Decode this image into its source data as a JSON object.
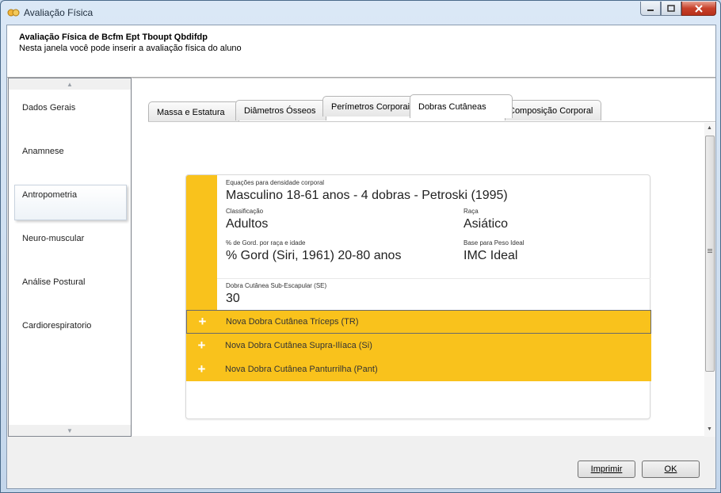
{
  "window": {
    "title": "Avaliação Física"
  },
  "header": {
    "title": "Avaliação Física de Bcfm Ept Tboupt Qbdifdp",
    "subtitle": "Nesta janela você pode inserir a avaliação física do aluno"
  },
  "sidebar": {
    "items": [
      {
        "label": "Dados Gerais"
      },
      {
        "label": "Anamnese"
      },
      {
        "label": "Antropometria"
      },
      {
        "label": "Neuro-muscular"
      },
      {
        "label": "Análise Postural"
      },
      {
        "label": "Cardiorespiratorio"
      }
    ],
    "active": "Antropometria"
  },
  "tabs": [
    {
      "label": "Massa e Estatura"
    },
    {
      "label": "Diâmetros Ósseos"
    },
    {
      "label": "Perímetros Corporais"
    },
    {
      "label": "Dobras Cutâneas"
    },
    {
      "label": "Composição Corporal"
    }
  ],
  "active_tab": "Dobras Cutâneas",
  "card": {
    "equation_label": "Equações para densidade corporal",
    "equation_value": "Masculino 18-61 anos - 4 dobras - Petroski (1995)",
    "classification_label": "Classificação",
    "classification_value": "Adultos",
    "race_label": "Raça",
    "race_value": "Asiático",
    "fat_label": "% de Gord. por raça e idade",
    "fat_value": "% Gord (Siri, 1961) 20-80 anos",
    "ideal_label": "Base para Peso Ideal",
    "ideal_value": "IMC Ideal",
    "fold_label": "Dobra Cutânea Sub-Escapular (SE)",
    "fold_value": "30",
    "add_rows": [
      {
        "label": "Nova Dobra Cutânea Tríceps (TR)"
      },
      {
        "label": "Nova Dobra Cutânea Supra-Ilíaca (Si)"
      },
      {
        "label": "Nova Dobra Cutânea Panturrilha (Pant)"
      }
    ]
  },
  "buttons": {
    "print": "Imprimir",
    "ok": "OK"
  },
  "colors": {
    "accent": "#f9c21c",
    "close": "#c7412b"
  },
  "icons": [
    "app-icon",
    "minimize-icon",
    "maximize-icon",
    "close-icon",
    "plus-icon",
    "scroll-up-icon",
    "scroll-down-icon"
  ]
}
